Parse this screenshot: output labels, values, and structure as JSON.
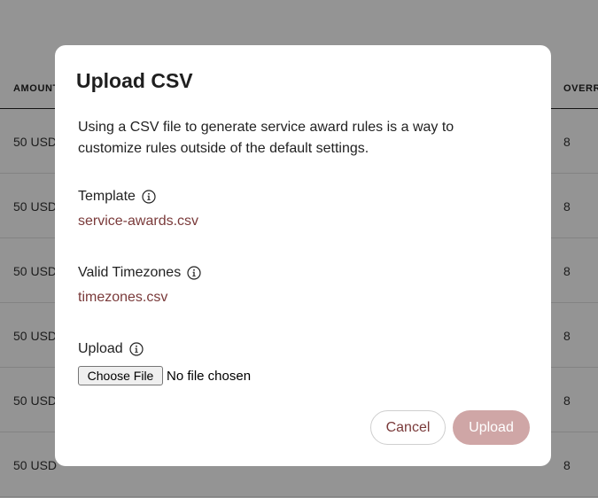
{
  "table": {
    "col_amount_header": "AMOUNT",
    "col_override_header": "OVERRIDE",
    "rows": [
      {
        "amount": "50 USD",
        "override": "8"
      },
      {
        "amount": "50 USD",
        "override": "8"
      },
      {
        "amount": "50 USD",
        "override": "8"
      },
      {
        "amount": "50 USD",
        "override": "8"
      },
      {
        "amount": "50 USD",
        "override": "8"
      },
      {
        "amount": "50 USD",
        "override": "8"
      }
    ]
  },
  "modal": {
    "title": "Upload CSV",
    "description": "Using a CSV file to generate service award rules is a way to customize rules outside of the default settings.",
    "template_label": "Template",
    "template_file": "service-awards.csv",
    "timezones_label": "Valid Timezones",
    "timezones_file": "timezones.csv",
    "upload_label": "Upload",
    "choose_file_label": "Choose File",
    "no_file_text": "No file chosen",
    "cancel_label": "Cancel",
    "upload_button_label": "Upload",
    "icons": {
      "info": "info-circle-icon"
    }
  },
  "colors": {
    "link": "#7a3a3a",
    "upload_button_disabled": "#cfa6a6",
    "overlay": "rgba(0,0,0,0.42)"
  }
}
